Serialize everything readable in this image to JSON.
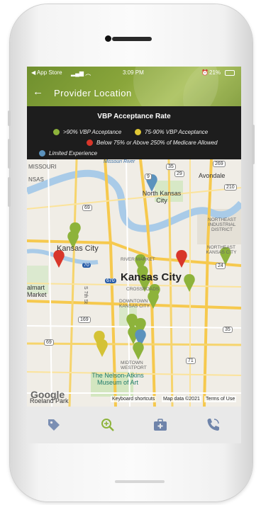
{
  "status": {
    "carrier": "◀ App Store",
    "time": "3:09 PM",
    "battery": "21%"
  },
  "header": {
    "title": "Provider Location"
  },
  "legend": {
    "title": "VBP Acceptance Rate",
    "items": [
      {
        "label": ">90% VBP Acceptance",
        "color": "#8db33b"
      },
      {
        "label": "75-90% VBP Acceptance",
        "color": "#e0c735"
      },
      {
        "label": "Below 75% or Above 250% of Medicare Allowed",
        "color": "#d8362a"
      },
      {
        "label": "Limited Experience",
        "color": "#5b92bd"
      }
    ]
  },
  "map": {
    "labels": {
      "missouri": "MISSOURI",
      "nsas": "NSAS",
      "kansas_city_kansas": "Kansas City",
      "north_kc": "North Kansas City",
      "avondale": "Avondale",
      "northeast": "NORTHEAST INDUSTRIAL DISTRICT",
      "northeast2": "NORTHEAST KANSAS CITY",
      "kansas_city": "Kansas City",
      "river_market": "RIVER MARKET",
      "crossroads": "CROSSROADS",
      "downtown": "DOWNTOWN KANSAS CITY",
      "midtown": "MIDTOWN WESTPORT",
      "nelson": "The Nelson-Atkins Museum of Art",
      "elmart": "almart Market",
      "roeland": "Roeland Park",
      "missouri_river": "Missouri River",
      "st7": "S 7th St",
      "i35": "35",
      "i29": "29",
      "i70": "70",
      "i670": "670",
      "r269": "269",
      "r210": "210",
      "r69": "69",
      "r169": "169",
      "r9": "9",
      "r24": "24",
      "r71": "71",
      "r35b": "35"
    },
    "google": "Google",
    "keyboard": "Keyboard shortcuts",
    "mapdata": "Map data ©2021",
    "terms": "Terms of Use"
  },
  "nav": [
    {
      "icon": "tag-icon"
    },
    {
      "icon": "zoom-in-icon"
    },
    {
      "icon": "medical-bag-icon"
    },
    {
      "icon": "phone-icon"
    }
  ]
}
